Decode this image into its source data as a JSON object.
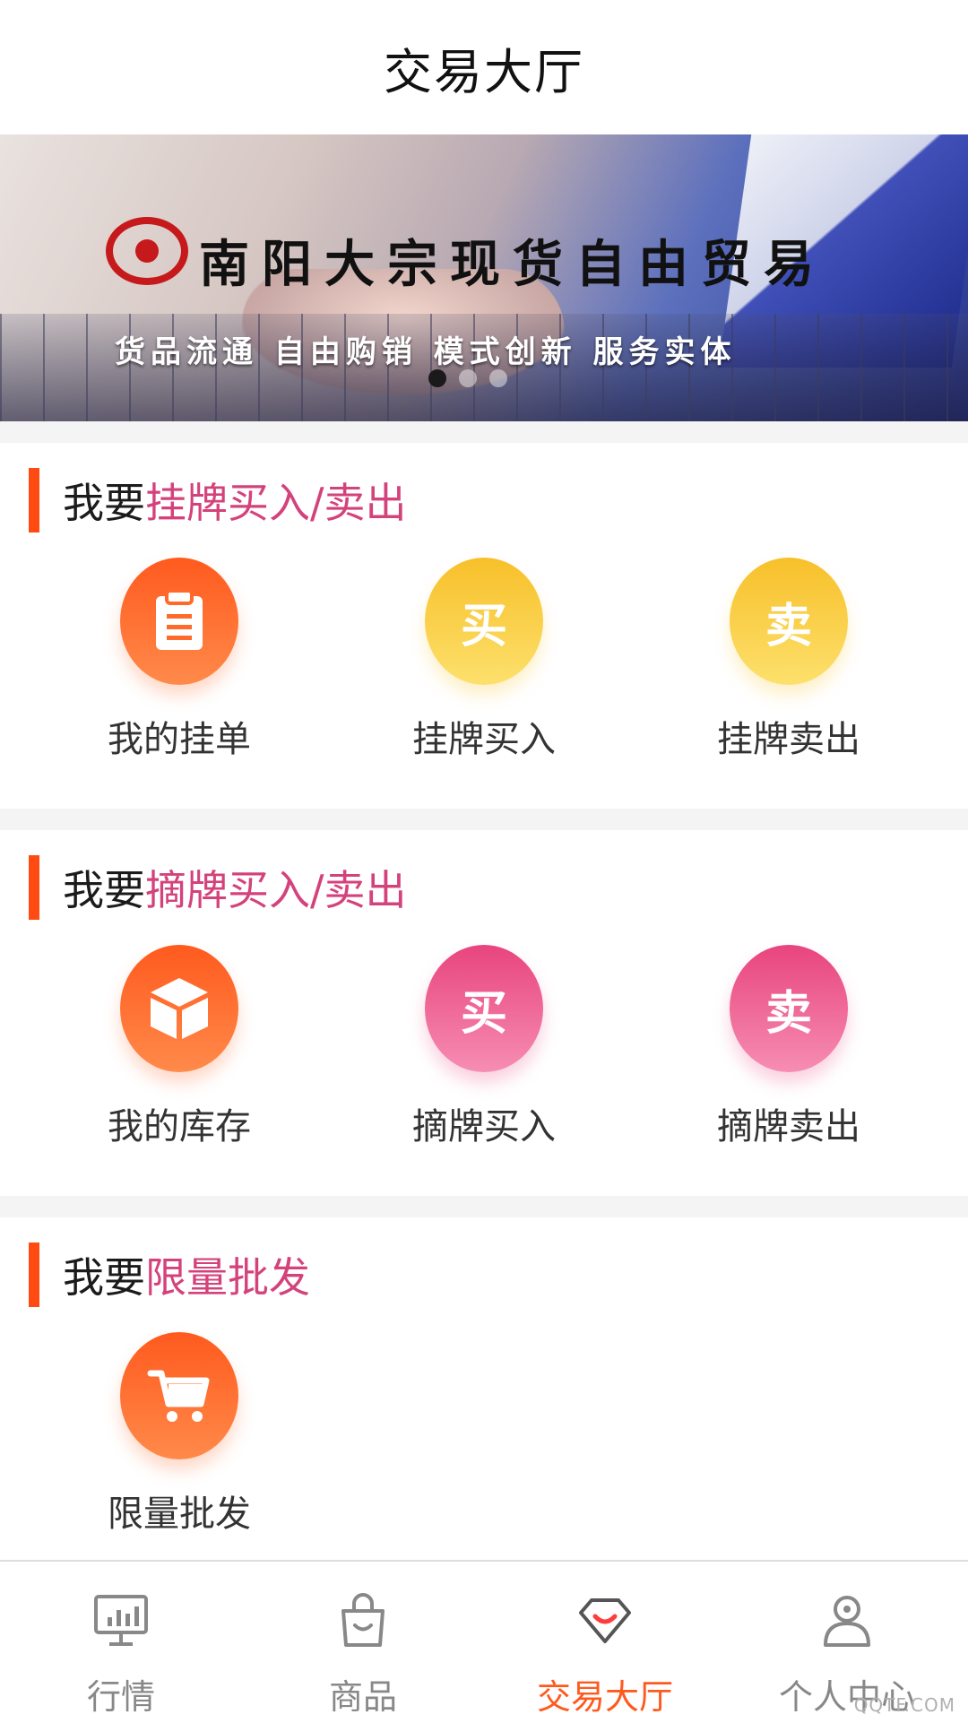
{
  "header": {
    "title": "交易大厅"
  },
  "banner": {
    "title": "南阳大宗现货自由贸易",
    "slogan": "货品流通 自由购销 模式创新 服务实体",
    "slide_count": 3,
    "active_slide": 1
  },
  "sections": [
    {
      "title_prefix": "我要",
      "title_highlight": "挂牌买入/卖出",
      "items": [
        {
          "label": "我的挂单",
          "icon": "clipboard-icon",
          "color": "#ff6a2b"
        },
        {
          "label": "挂牌买入",
          "icon": "buy-char-icon",
          "glyph": "买",
          "color": "#f9c83a"
        },
        {
          "label": "挂牌卖出",
          "icon": "sell-char-icon",
          "glyph": "卖",
          "color": "#f9c83a"
        }
      ]
    },
    {
      "title_prefix": "我要",
      "title_highlight": "摘牌买入/卖出",
      "items": [
        {
          "label": "我的库存",
          "icon": "cube-icon",
          "color": "#ff6a2b"
        },
        {
          "label": "摘牌买入",
          "icon": "buy-char-icon",
          "glyph": "买",
          "color": "#ec5a8f"
        },
        {
          "label": "摘牌卖出",
          "icon": "sell-char-icon",
          "glyph": "卖",
          "color": "#ec5a8f"
        }
      ]
    },
    {
      "title_prefix": "我要",
      "title_highlight": "限量批发",
      "items": [
        {
          "label": "限量批发",
          "icon": "cart-icon",
          "color": "#ff6a2b"
        }
      ]
    }
  ],
  "colors": {
    "accent": "#ff5a1e",
    "highlight": "#d4427c",
    "bar": "#ff4b12",
    "inactive": "#888888"
  },
  "tabbar": {
    "items": [
      {
        "label": "行情",
        "icon": "monitor-chart-icon",
        "active": false
      },
      {
        "label": "商品",
        "icon": "shopping-bag-icon",
        "active": false
      },
      {
        "label": "交易大厅",
        "icon": "diamond-smile-icon",
        "active": true
      },
      {
        "label": "个人中心",
        "icon": "user-icon",
        "active": false
      }
    ]
  },
  "watermark": "QQTF.COM"
}
